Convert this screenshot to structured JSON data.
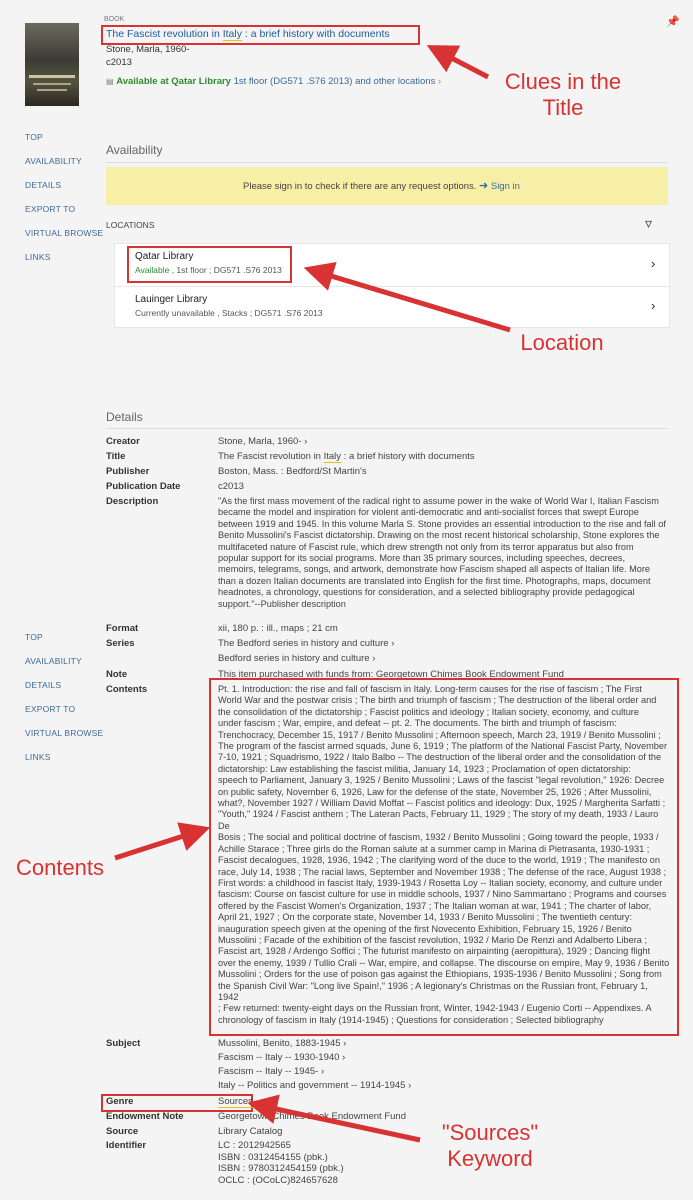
{
  "record": {
    "type_label": "BOOK",
    "title_parts": [
      "The Fascist revolution in ",
      "Italy",
      " : a brief history with documents"
    ],
    "author": "Stone, Marla, 1960-",
    "date": "c2013",
    "availability_status": "Available at Qatar Library",
    "availability_location": "1st floor (DG571 .S76 2013) and other locations",
    "chevron": "›"
  },
  "nav": {
    "items": [
      "TOP",
      "AVAILABILITY",
      "DETAILS",
      "EXPORT TO",
      "VIRTUAL BROWSE",
      "LINKS"
    ]
  },
  "availability": {
    "heading": "Availability",
    "signin_notice": "Please sign in to check if there are any request options.",
    "signin_label": "Sign in",
    "locations_label": "LOCATIONS",
    "locations": [
      {
        "name": "Qatar Library",
        "status": "Available",
        "detail": " , 1st floor ; DG571 .S76 2013"
      },
      {
        "name": "Lauinger Library",
        "status": "Currently unavailable",
        "detail": " , Stacks ; DG571 .S76 2013"
      }
    ]
  },
  "details": {
    "heading": "Details",
    "creator_label": "Creator",
    "creator": "Stone, Marla, 1960-",
    "title_label": "Title",
    "publisher_label": "Publisher",
    "publisher": "Boston, Mass. : Bedford/St Martin's",
    "pubdate_label": "Publication Date",
    "pubdate": "c2013",
    "description_label": "Description",
    "description": [
      "\"As the first mass movement of the radical right to assume power in the wake of World War I, Italian Fascism",
      "became the model and inspiration for violent anti-democratic and anti-socialist forces that swept Europe",
      "between 1919 and 1945. In this volume Marla S. Stone provides an essential introduction to the rise and fall of",
      "Benito Mussolini's Fascist dictatorship. Drawing on the most recent historical scholarship, Stone explores the",
      "multifaceted nature of Fascist rule, which drew strength not only from its terror apparatus but also from",
      "popular support for its social programs. More than 35 primary sources, including speeches, decrees,",
      "memoirs, telegrams, songs, and artwork, demonstrate how Fascism shaped all aspects of Italian life. More",
      "than a dozen Italian documents are translated into English for the first time. Photographs, maps, document",
      "headnotes, a chronology, questions for consideration, and a selected bibliography provide pedagogical",
      "support.\"--Publisher description"
    ],
    "format_label": "Format",
    "format": "xii, 180 p. : ill., maps ; 21 cm",
    "series_label": "Series",
    "series": [
      "The Bedford series in history and culture",
      "Bedford series in history and culture"
    ],
    "note_label": "Note",
    "note": "This item purchased with funds from: Georgetown Chimes Book Endowment Fund",
    "contents_label": "Contents",
    "contents": [
      "Pt. 1. Introduction: the rise and fall of fascism in Italy. Long-term causes for the rise of fascism ; The First",
      "World War and the postwar crisis ; The birth and triumph of fascism ; The destruction of the liberal order and",
      "the consolidation of the dictatorship ; Fascist politics and ideology ; Italian society, economy, and culture",
      "under fascism ; War, empire, and defeat -- pt. 2. The documents. The birth and triumph of fascism:",
      "Trenchocracy, December 15, 1917 / Benito Mussolini ; Afternoon speech, March 23, 1919 / Benito Mussolini ;",
      "The program of the fascist armed squads, June 6, 1919 ; The platform of the National Fascist Party, November",
      "7-10, 1921 ; Squadrismo, 1922 / Italo Balbo -- The destruction of the liberal order and the consolidation of the",
      "dictatorship: Law establishing the fascist militia, January 14, 1923 ; Proclamation of open dictatorship:",
      "speech to Parliament, January 3, 1925 / Benito Mussolini ; Laws of the fascist \"legal revolution,\" 1926: Decree",
      "on public safety, November 6, 1926, Law for the defense of the state, November 25, 1926 ; After Mussolini,",
      "what?, November 1927 / William David Moffat -- Fascist politics and ideology: Dux, 1925 / Margherita Sarfatti ;",
      "\"Youth,\" 1924 / Fascist anthem ; The Lateran Pacts, February 11, 1929 ; The story of my death, 1933 / Lauro De",
      "Bosis ; The social and political doctrine of fascism, 1932 / Benito Mussolini ; Going toward the people, 1933 /",
      "Achille Starace ; Three girls do the Roman salute at a summer camp in Marina di Pietrasanta, 1930-1931 ;",
      "Fascist decalogues, 1928, 1936, 1942 ; The clarifying word of the duce to the world, 1919 ; The manifesto on",
      "race, July 14, 1938 ; The racial laws, September and November 1938 ; The defense of the race, August 1938 ;",
      "First words: a childhood in fascist Italy, 1939-1943 / Rosetta Loy -- Italian society, economy, and culture under",
      "fascism: Course on fascist culture for use in middle schools, 1937 / Nino Sammartano ; Programs and courses",
      "offered by the Fascist Women's Organization, 1937 ; The Italian woman at war, 1941 ; The charter of labor,",
      "April 21, 1927 ; On the corporate state, November 14, 1933 / Benito Mussolini ; The twentieth century:",
      "inauguration speech given at the opening of the first Novecento Exhibition, February 15, 1926 / Benito",
      "Mussolini ; Facade of the exhibition of the fascist revolution, 1932 / Mario De Renzi and Adalberto Libera ;",
      "Fascist art, 1928 / Ardengo Soffici ; The futurist manifesto on airpainting (aeropittura), 1929 ; Dancing flight",
      "over the enemy, 1939 / Tullio Crali -- War, empire, and collapse. The discourse on empire, May 9, 1936 / Benito",
      "Mussolini ; Orders for the use of poison gas against the Ethiopians, 1935-1936 / Benito Mussolini ; Song from",
      "the Spanish Civil War: \"Long live Spain!,\" 1936 ; A legionary's Christmas on the Russian front, February 1, 1942",
      "; Few returned: twenty-eight days on the Russian front, Winter, 1942-1943 / Eugenio Corti -- Appendixes. A",
      "chronology of fascism in Italy (1914-1945) ; Questions for consideration ; Selected bibliography"
    ],
    "subject_label": "Subject",
    "subjects": [
      "Mussolini, Benito, 1883-1945",
      "Fascism -- Italy -- 1930-1940",
      "Fascism -- Italy -- 1945-",
      "Italy -- Politics and government -- 1914-1945"
    ],
    "genre_label": "Genre",
    "genre": "Sources",
    "endowment_label": "Endowment Note",
    "endowment": "Georgetown Chimes Book Endowment Fund",
    "source_label": "Source",
    "source": "Library Catalog",
    "identifier_label": "Identifier",
    "identifiers": [
      "LC : 2012942565",
      "ISBN : 0312454155 (pbk.)",
      "ISBN : 9780312454159 (pbk.)",
      "OCLC : (OCoLC)824657628"
    ]
  },
  "annotations": {
    "title_callout": "Clues in the\nTitle",
    "location_callout": "Location",
    "contents_callout": "Contents",
    "sources_callout": "\"Sources\"\nKeyword"
  },
  "colors": {
    "annotation_red": "#d83232",
    "available_green": "#2e8b2e",
    "link_blue": "#3d6a99",
    "signin_bar": "#f8efa6"
  }
}
